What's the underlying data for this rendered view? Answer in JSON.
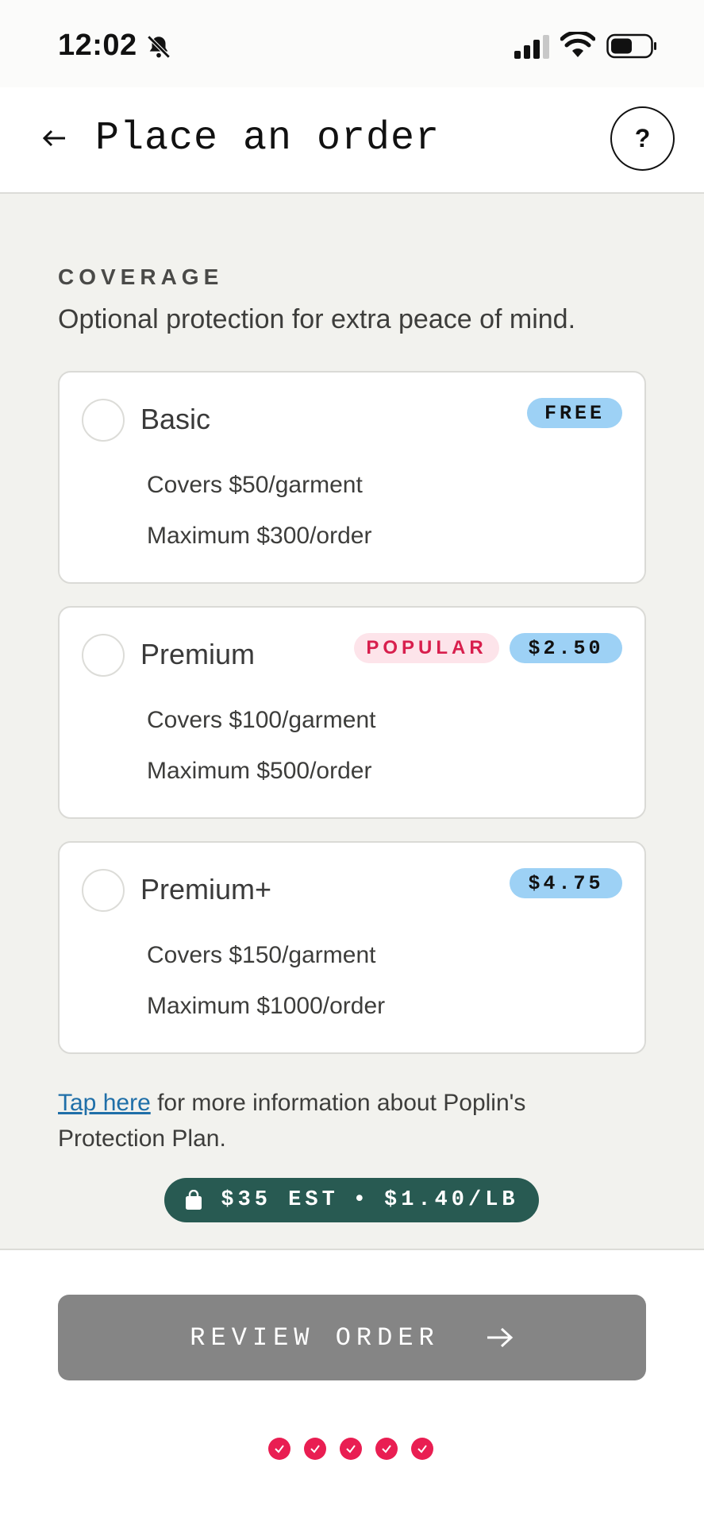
{
  "status_bar": {
    "time": "12:02",
    "bell_icon": "bell-slash-icon",
    "signal_icon": "cellular-signal-icon",
    "wifi_icon": "wifi-icon",
    "battery_icon": "battery-icon"
  },
  "header": {
    "title": "Place an order",
    "back_icon": "arrow-left-icon",
    "help_label": "?"
  },
  "coverage": {
    "label": "COVERAGE",
    "subtitle": "Optional protection for extra peace of mind.",
    "options": [
      {
        "name": "Basic",
        "price_badge": "FREE",
        "lines": [
          "Covers $50/garment",
          "Maximum $300/order"
        ],
        "selected": false
      },
      {
        "name": "Premium",
        "popular_badge": "POPULAR",
        "price_badge": "$2.50",
        "lines": [
          "Covers $100/garment",
          "Maximum $500/order"
        ],
        "selected": false
      },
      {
        "name": "Premium+",
        "price_badge": "$4.75",
        "lines": [
          "Covers $150/garment",
          "Maximum $1000/order"
        ],
        "selected": false
      }
    ]
  },
  "info": {
    "link_text": "Tap here",
    "rest_text": " for more information about Poplin's Protection Plan."
  },
  "estimate": {
    "price": "$35 EST",
    "separator": "•",
    "rate": "$1.40/LB",
    "icon": "shopping-bag-icon"
  },
  "footer": {
    "review_label": "REVIEW ORDER",
    "arrow_icon": "arrow-right-icon",
    "progress_steps_completed": 5
  },
  "colors": {
    "accent_pink": "#e91e52",
    "price_badge_blue": "#9dd1f5",
    "estimate_green": "#285a52",
    "button_gray": "#858585"
  }
}
